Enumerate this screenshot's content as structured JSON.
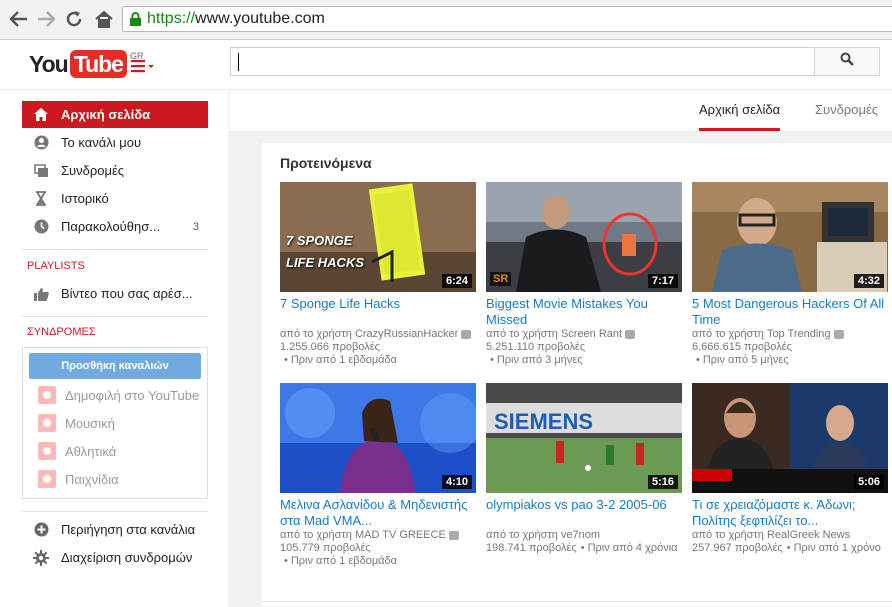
{
  "browser": {
    "url_scheme": "https://",
    "url_rest": "www.youtube.com"
  },
  "masthead": {
    "logo_you": "You",
    "logo_tube": "Tube",
    "region": "GR"
  },
  "sidebar": {
    "items": [
      {
        "label": "Αρχική σελίδα",
        "icon": "home-icon"
      },
      {
        "label": "Το κανάλι μου",
        "icon": "user-icon"
      },
      {
        "label": "Συνδρομές",
        "icon": "subscriptions-icon"
      },
      {
        "label": "Ιστορικό",
        "icon": "hourglass-icon"
      },
      {
        "label": "Παρακολούθησ...",
        "icon": "clock-icon",
        "count": "3"
      }
    ],
    "playlists_header": "PLAYLISTS",
    "liked_videos": "Βίντεο που σας αρέσ...",
    "subscriptions_header": "ΣΥΝΔΡΟΜΕΣ",
    "add_channels_button": "Προσθήκη καναλιών",
    "channels": [
      "Δημοφιλή στο YouTube",
      "Μουσική",
      "Αθλητικά",
      "Παιχνίδια"
    ],
    "browse_channels": "Περιήγηση στα κανάλια",
    "manage_subscriptions": "Διαχείριση συνδρομών"
  },
  "tabs": {
    "home": "Αρχική σελίδα",
    "subscriptions": "Συνδρομές"
  },
  "shelf": {
    "title": "Προτεινόμενα",
    "videos": [
      {
        "title": "7 Sponge Life Hacks",
        "channel": "από το χρήστη CrazyRussianHacker",
        "views": "1.255.066 προβολές",
        "age": "Πριν από 1 εβδομάδα",
        "duration": "6:24",
        "thumb_text": "7 SPONGE\nLIFE HACKS"
      },
      {
        "title": "Biggest Movie Mistakes You Missed",
        "channel": "από το χρήστη Screen Rant",
        "views": "5.251.110 προβολές",
        "age": "Πριν από 3 μήνες",
        "duration": "7:17",
        "thumb_text": "SR"
      },
      {
        "title": "5 Most Dangerous Hackers Of All Time",
        "channel": "από το χρήστη Top Trending",
        "views": "6.666.615 προβολές",
        "age": "Πριν από 5 μήνες",
        "duration": "4:32"
      },
      {
        "title": "Μελινα Ασλανίδου & Μηδενιστής στα Mad VMA...",
        "channel": "από το χρήστη MAD TV GREECE",
        "views": "105.779 προβολές",
        "age": "Πριν από 1 εβδομάδα",
        "duration": "4:10"
      },
      {
        "title": "olympiakos vs pao 3-2 2005-06",
        "channel": "από το χρήστη ve7nom",
        "views": "198.741 προβολές",
        "age": "Πριν από 4 χρόνια",
        "duration": "5:16",
        "thumb_text": "SIEMENS"
      },
      {
        "title": "Τι σε χρειαζόμαστε κ. Άδωνι; Πολίτης ξεφτιλίζει το...",
        "channel": "από το χρήστη RealGreek News",
        "views": "257.967 προβολές",
        "age": "Πριν από 1 χρόνο",
        "duration": "5:06"
      }
    ]
  },
  "colors": {
    "brand_red": "#cc181e",
    "link_blue": "#167ac6",
    "button_blue": "#71aadf"
  }
}
